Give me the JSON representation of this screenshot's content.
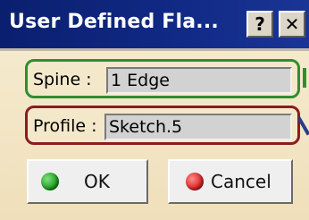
{
  "window": {
    "title": "User Defined Fla...",
    "help_label": "?",
    "close_label": "✕"
  },
  "form": {
    "spine": {
      "label": "Spine :",
      "value": "1 Edge",
      "outline_color": "#2f8f2f"
    },
    "profile": {
      "label": "Profile :",
      "value": "Sketch.5",
      "outline_color": "#8a1d1d"
    }
  },
  "buttons": {
    "ok": {
      "label": "OK",
      "icon": "green-dot-icon",
      "color": "#1a9a1a"
    },
    "cancel": {
      "label": "Cancel",
      "icon": "red-dot-icon",
      "color": "#d62020"
    }
  }
}
